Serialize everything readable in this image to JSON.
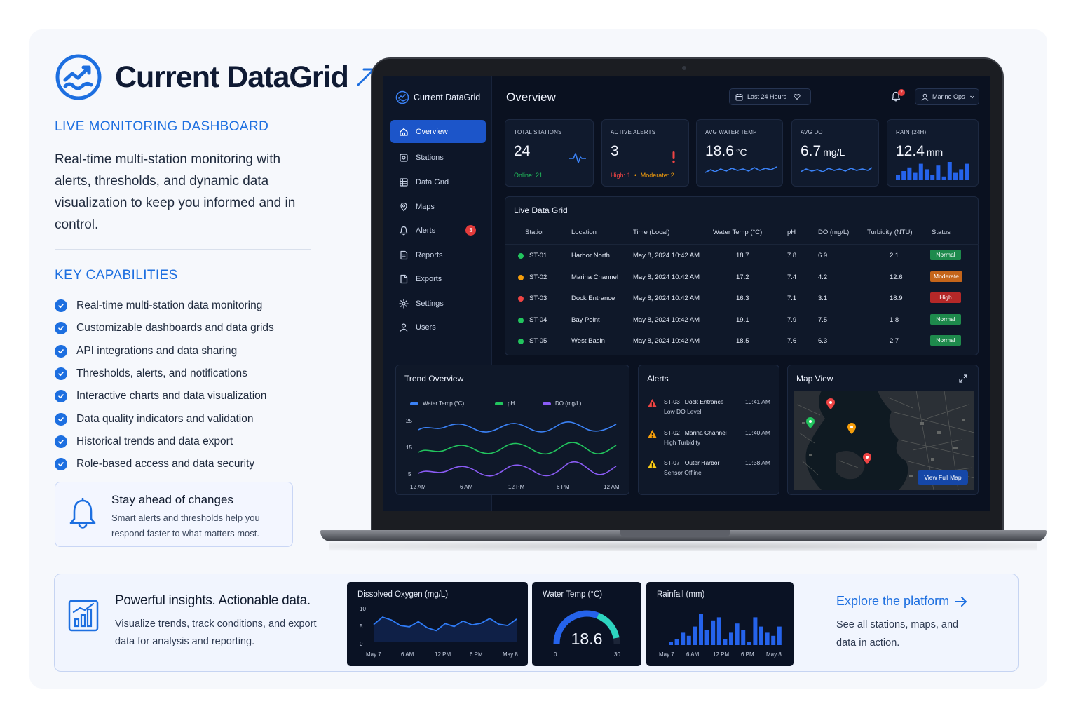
{
  "brand": {
    "name": "Current DataGrid",
    "eyebrow": "LIVE MONITORING DASHBOARD",
    "lead": "Real-time multi-station monitoring with alerts, thresholds, and dynamic data visualization to keep you informed and in control."
  },
  "capabilities": {
    "title": "KEY CAPABILITIES",
    "items": [
      "Real-time multi-station data monitoring",
      "Customizable dashboards and data grids",
      "API integrations and data sharing",
      "Thresholds, alerts, and notifications",
      "Interactive charts and data visualization",
      "Data quality indicators and validation",
      "Historical trends and data export",
      "Role-based access and data security"
    ]
  },
  "ahead": {
    "title": "Stay ahead of changes",
    "text": "Smart alerts and thresholds help you respond faster to what matters most."
  },
  "app": {
    "brand": "Current DataGrid",
    "nav": [
      {
        "label": "Overview",
        "icon": "home-icon",
        "active": true
      },
      {
        "label": "Stations",
        "icon": "station-icon"
      },
      {
        "label": "Data Grid",
        "icon": "grid-icon"
      },
      {
        "label": "Maps",
        "icon": "map-pin-icon"
      },
      {
        "label": "Alerts",
        "icon": "bell-icon",
        "badge": "3"
      },
      {
        "label": "Reports",
        "icon": "file-icon"
      },
      {
        "label": "Exports",
        "icon": "export-icon"
      },
      {
        "label": "Settings",
        "icon": "gear-icon"
      },
      {
        "label": "Users",
        "icon": "user-icon"
      }
    ],
    "page_title": "Overview",
    "range": "Last 24 Hours",
    "notif_count": "2",
    "user": "Marine Ops",
    "kpis": {
      "stations": {
        "label": "TOTAL STATIONS",
        "value": "24",
        "sub": "Online: 21"
      },
      "alerts": {
        "label": "ACTIVE ALERTS",
        "value": "3",
        "sub_high": "High: 1",
        "sub_sep": "•",
        "sub_mod": "Moderate: 2"
      },
      "temp": {
        "label": "AVG WATER TEMP",
        "value": "18.6",
        "unit": "°C"
      },
      "do": {
        "label": "AVG DO",
        "value": "6.7",
        "unit": "mg/L"
      },
      "rain": {
        "label": "RAIN (24H)",
        "value": "12.4",
        "unit": "mm",
        "bars": [
          3,
          5,
          7,
          4,
          9,
          6,
          3,
          8,
          2,
          10,
          4,
          6,
          9
        ]
      }
    },
    "grid": {
      "title": "Live Data Grid",
      "columns": [
        "Station",
        "Location",
        "Time (Local)",
        "Water Temp (°C)",
        "pH",
        "DO (mg/L)",
        "Turbidity (NTU)",
        "Status"
      ],
      "rows": [
        {
          "station": "ST-01",
          "location": "Harbor North",
          "time": "May 8, 2024 10:42 AM",
          "temp": "18.7",
          "ph": "7.8",
          "do": "6.9",
          "turb": "2.1",
          "status": "Normal",
          "dot": "#22c55e",
          "status_color": "#1e8a4c"
        },
        {
          "station": "ST-02",
          "location": "Marina Channel",
          "time": "May 8, 2024 10:42 AM",
          "temp": "17.2",
          "ph": "7.4",
          "do": "4.2",
          "turb": "12.6",
          "status": "Moderate",
          "dot": "#f59e0b",
          "status_color": "#c4651a"
        },
        {
          "station": "ST-03",
          "location": "Dock Entrance",
          "time": "May 8, 2024 10:42 AM",
          "temp": "16.3",
          "ph": "7.1",
          "do": "3.1",
          "turb": "18.9",
          "status": "High",
          "dot": "#ef4444",
          "status_color": "#b42828"
        },
        {
          "station": "ST-04",
          "location": "Bay Point",
          "time": "May 8, 2024 10:42 AM",
          "temp": "19.1",
          "ph": "7.9",
          "do": "7.5",
          "turb": "1.8",
          "status": "Normal",
          "dot": "#22c55e",
          "status_color": "#1e8a4c"
        },
        {
          "station": "ST-05",
          "location": "West Basin",
          "time": "May 8, 2024 10:42 AM",
          "temp": "18.5",
          "ph": "7.6",
          "do": "6.3",
          "turb": "2.7",
          "status": "Normal",
          "dot": "#22c55e",
          "status_color": "#1e8a4c"
        }
      ]
    },
    "trend": {
      "title": "Trend Overview",
      "legend": [
        {
          "name": "Water Temp (°C)",
          "color": "#3b82f6"
        },
        {
          "name": "pH",
          "color": "#22c55e"
        },
        {
          "name": "DO (mg/L)",
          "color": "#8b5cf6"
        }
      ],
      "yticks": [
        "25",
        "15",
        "5"
      ],
      "xticks": [
        "12 AM",
        "6 AM",
        "12 PM",
        "6 PM",
        "12 AM"
      ]
    },
    "alerts_panel": {
      "title": "Alerts",
      "items": [
        {
          "station": "ST-03",
          "place": "Dock Entrance",
          "desc": "Low DO Level",
          "time": "10:41 AM",
          "color": "#ef4444"
        },
        {
          "station": "ST-02",
          "place": "Marina Channel",
          "desc": "High Turbidity",
          "time": "10:40 AM",
          "color": "#f59e0b"
        },
        {
          "station": "ST-07",
          "place": "Outer Harbor",
          "desc": "Sensor Offline",
          "time": "10:38 AM",
          "color": "#facc15"
        }
      ]
    },
    "map": {
      "title": "Map View",
      "button": "View Full Map"
    }
  },
  "strip": {
    "title": "Powerful insights. Actionable data.",
    "text": "Visualize trends, track conditions, and export data for analysis and reporting.",
    "explore": "Explore the platform",
    "explore_text": "See all stations, maps, and data in action."
  },
  "chart_data": [
    {
      "type": "line",
      "title": "Dissolved Oxygen (mg/L)",
      "ylim": [
        0,
        10
      ],
      "yticks": [
        "10",
        "5",
        "0"
      ],
      "xticks": [
        "May 7",
        "6 AM",
        "12 PM",
        "6 PM",
        "May 8"
      ],
      "x": [
        0,
        1,
        2,
        3,
        4,
        5,
        6,
        7,
        8,
        9,
        10,
        11,
        12,
        13,
        14,
        15,
        16
      ],
      "values": [
        5.5,
        7.8,
        6.9,
        5.2,
        4.8,
        6.4,
        4.5,
        3.6,
        5.8,
        4.9,
        6.6,
        5.4,
        5.9,
        7.4,
        5.6,
        5.2,
        7.2
      ]
    },
    {
      "type": "gauge",
      "title": "Water Temp (°C)",
      "value": 18.6,
      "range": [
        0,
        30
      ],
      "min_label": "0",
      "max_label": "30",
      "display": "18.6"
    },
    {
      "type": "bar",
      "title": "Rainfall (mm)",
      "xticks": [
        "May 7",
        "6 AM",
        "12 PM",
        "6 PM",
        "May 8"
      ],
      "values": [
        1,
        2,
        4,
        3,
        6,
        10,
        5,
        8,
        9,
        2,
        4,
        7,
        5,
        1,
        9,
        6,
        4,
        3,
        6
      ]
    }
  ]
}
